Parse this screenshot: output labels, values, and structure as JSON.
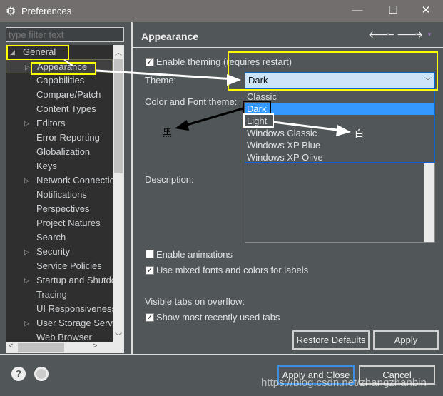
{
  "window": {
    "title": "Preferences",
    "minimize": "—",
    "maximize": "☐",
    "close": "✕"
  },
  "filter": {
    "placeholder": "type filter text"
  },
  "tree": {
    "items": [
      {
        "label": "General",
        "expanded": true
      },
      {
        "label": "Appearance",
        "child": true,
        "arrow": true
      },
      {
        "label": "Capabilities",
        "child": true
      },
      {
        "label": "Compare/Patch",
        "child": true
      },
      {
        "label": "Content Types",
        "child": true
      },
      {
        "label": "Editors",
        "child": true,
        "arrow": true
      },
      {
        "label": "Error Reporting",
        "child": true
      },
      {
        "label": "Globalization",
        "child": true
      },
      {
        "label": "Keys",
        "child": true
      },
      {
        "label": "Network Connections",
        "child": true,
        "arrow": true
      },
      {
        "label": "Notifications",
        "child": true
      },
      {
        "label": "Perspectives",
        "child": true
      },
      {
        "label": "Project Natures",
        "child": true
      },
      {
        "label": "Search",
        "child": true
      },
      {
        "label": "Security",
        "child": true,
        "arrow": true
      },
      {
        "label": "Service Policies",
        "child": true
      },
      {
        "label": "Startup and Shutdown",
        "child": true,
        "arrow": true
      },
      {
        "label": "Tracing",
        "child": true
      },
      {
        "label": "UI Responsiveness",
        "child": true
      },
      {
        "label": "User Storage Service",
        "child": true,
        "arrow": true
      },
      {
        "label": "Web Browser",
        "child": true
      }
    ]
  },
  "page": {
    "title": "Appearance",
    "enable_theming": "Enable theming (requires restart)",
    "theme_label": "Theme:",
    "theme_value": "Dark",
    "theme_options": [
      "Classic",
      "Dark",
      "Light",
      "Windows Classic",
      "Windows XP Blue",
      "Windows XP Olive"
    ],
    "color_font_label": "Color and Font theme:",
    "description_label": "Description:",
    "enable_animations": "Enable animations",
    "mixed_fonts": "Use mixed fonts and colors for labels",
    "visible_tabs": "Visible tabs on overflow:",
    "show_recent": "Show most recently used tabs",
    "restore_defaults": "Restore Defaults",
    "apply": "Apply"
  },
  "footer": {
    "apply_close": "Apply and Close",
    "cancel": "Cancel"
  },
  "annotations": {
    "black": "黑",
    "white": "白",
    "watermark": "https://blog.csdn.net/zhangzhanbin"
  },
  "colors": {
    "highlight": "#3399ff",
    "annotation": "#ffff00"
  }
}
